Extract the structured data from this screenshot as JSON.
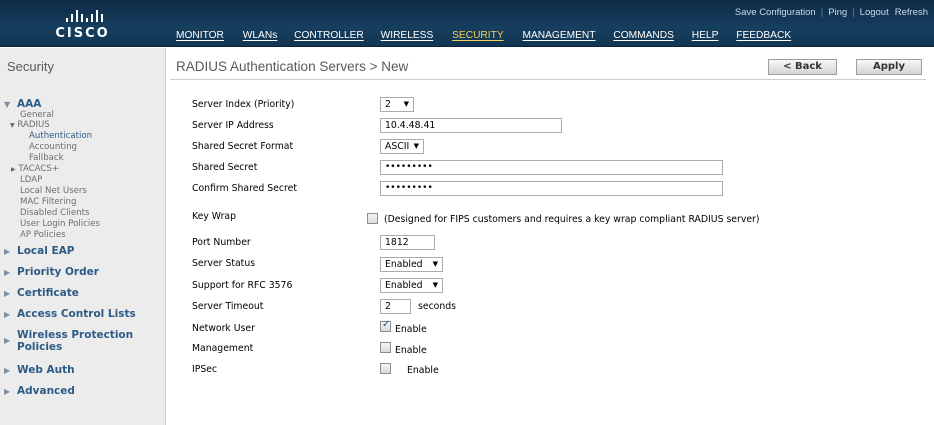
{
  "brand": {
    "logo_text": "CISCO"
  },
  "utility_links": [
    "Save Configuration",
    "Ping",
    "Logout",
    "Refresh"
  ],
  "main_nav": [
    {
      "label": "MONITOR",
      "active": false
    },
    {
      "label": "WLANs",
      "active": false
    },
    {
      "label": "CONTROLLER",
      "active": false
    },
    {
      "label": "WIRELESS",
      "active": false
    },
    {
      "label": "SECURITY",
      "active": true
    },
    {
      "label": "MANAGEMENT",
      "active": false
    },
    {
      "label": "COMMANDS",
      "active": false
    },
    {
      "label": "HELP",
      "active": false
    },
    {
      "label": "FEEDBACK",
      "active": false
    }
  ],
  "sidebar": {
    "title": "Security",
    "aaa": {
      "label": "AAA",
      "general": "General",
      "radius": "RADIUS",
      "radius_items": [
        "Authentication",
        "Accounting",
        "Fallback"
      ],
      "tacacs": "TACACS+",
      "items": [
        "LDAP",
        "Local Net Users",
        "MAC Filtering",
        "Disabled Clients",
        "User Login Policies",
        "AP Policies"
      ]
    },
    "sections": [
      "Local EAP",
      "Priority Order",
      "Certificate",
      "Access Control Lists",
      "Wireless Protection Policies",
      "Web Auth",
      "Advanced"
    ]
  },
  "page": {
    "title": "RADIUS Authentication Servers > New",
    "back_label": "< Back",
    "apply_label": "Apply"
  },
  "form": {
    "server_index": {
      "label": "Server Index (Priority)",
      "value": "2"
    },
    "server_ip": {
      "label": "Server IP Address",
      "value": "10.4.48.41"
    },
    "secret_format": {
      "label": "Shared Secret Format",
      "value": "ASCII"
    },
    "shared_secret": {
      "label": "Shared Secret",
      "value": "•••••••••"
    },
    "confirm_secret": {
      "label": "Confirm Shared Secret",
      "value": "•••••••••"
    },
    "key_wrap": {
      "label": "Key Wrap",
      "checked": false,
      "note": "(Designed for FIPS customers and requires a key wrap compliant RADIUS server)"
    },
    "port_number": {
      "label": "Port Number",
      "value": "1812"
    },
    "server_status": {
      "label": "Server Status",
      "value": "Enabled"
    },
    "rfc3576": {
      "label": "Support for RFC 3576",
      "value": "Enabled"
    },
    "server_timeout": {
      "label": "Server Timeout",
      "value": "2",
      "unit": "seconds"
    },
    "network_user": {
      "label": "Network User",
      "checked": true,
      "text": "Enable"
    },
    "management": {
      "label": "Management",
      "checked": false,
      "text": "Enable"
    },
    "ipsec": {
      "label": "IPSec",
      "checked": false,
      "text": "Enable"
    }
  }
}
